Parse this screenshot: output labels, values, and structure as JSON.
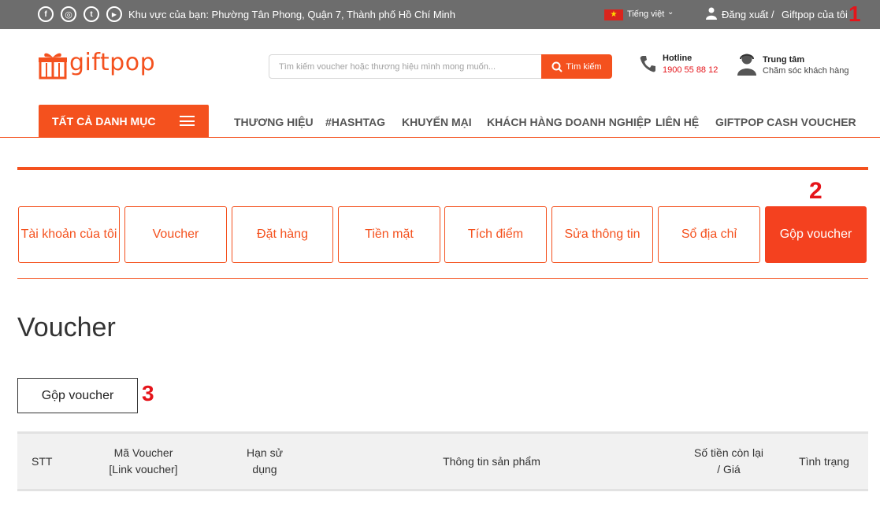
{
  "topbar": {
    "social": [
      {
        "name": "facebook-icon",
        "glyph": "f"
      },
      {
        "name": "instagram-icon",
        "glyph": "◎"
      },
      {
        "name": "twitter-icon",
        "glyph": "t"
      },
      {
        "name": "youtube-icon",
        "glyph": "▶"
      }
    ],
    "region": "Khu vực của bạn: Phường Tân Phong, Quận 7, Thành phố Hồ Chí Minh",
    "language": "Tiếng việt",
    "logout": "Đăng xuất",
    "separator": "/",
    "my_giftpop": "Giftpop của tôi"
  },
  "annotations": {
    "one": "1",
    "two": "2",
    "three": "3"
  },
  "header": {
    "logo": "giftpop",
    "search_placeholder": "Tìm kiếm voucher hoặc thương hiệu mình mong muốn...",
    "search_button": "Tìm kiếm",
    "hotline_label": "Hotline",
    "hotline_number": "1900 55 88 12",
    "care_title": "Trung tâm",
    "care_subtitle": "Chăm sóc khách hàng"
  },
  "nav": {
    "all_categories": "TẤT CẢ DANH MỤC",
    "items": [
      "THƯƠNG HIỆU",
      "#HASHTAG",
      "KHUYẾN MẠI",
      "KHÁCH HÀNG DOANH NGHIỆP",
      "LIÊN HỆ",
      "GIFTPOP CASH VOUCHER"
    ]
  },
  "account_tabs": [
    "Tài khoản của tôi",
    "Voucher",
    "Đặt hàng",
    "Tiền mặt",
    "Tích điểm",
    "Sửa thông tin",
    "Sổ địa chỉ",
    "Gộp voucher"
  ],
  "main": {
    "title": "Voucher",
    "merge_button": "Gộp voucher"
  },
  "table": {
    "headers": {
      "stt": "STT",
      "code_line1": "Mã Voucher",
      "code_line2": "[Link voucher]",
      "expiry_line1": "Hạn sử",
      "expiry_line2": "dụng",
      "product": "Thông tin sản phẩm",
      "remaining_line1": "Số tiền còn lại",
      "remaining_line2": "/ Giá",
      "status": "Tình trạng"
    }
  },
  "colors": {
    "brand": "#f4511e",
    "topbar": "#6d6d6d",
    "annotation": "#e5141a"
  }
}
